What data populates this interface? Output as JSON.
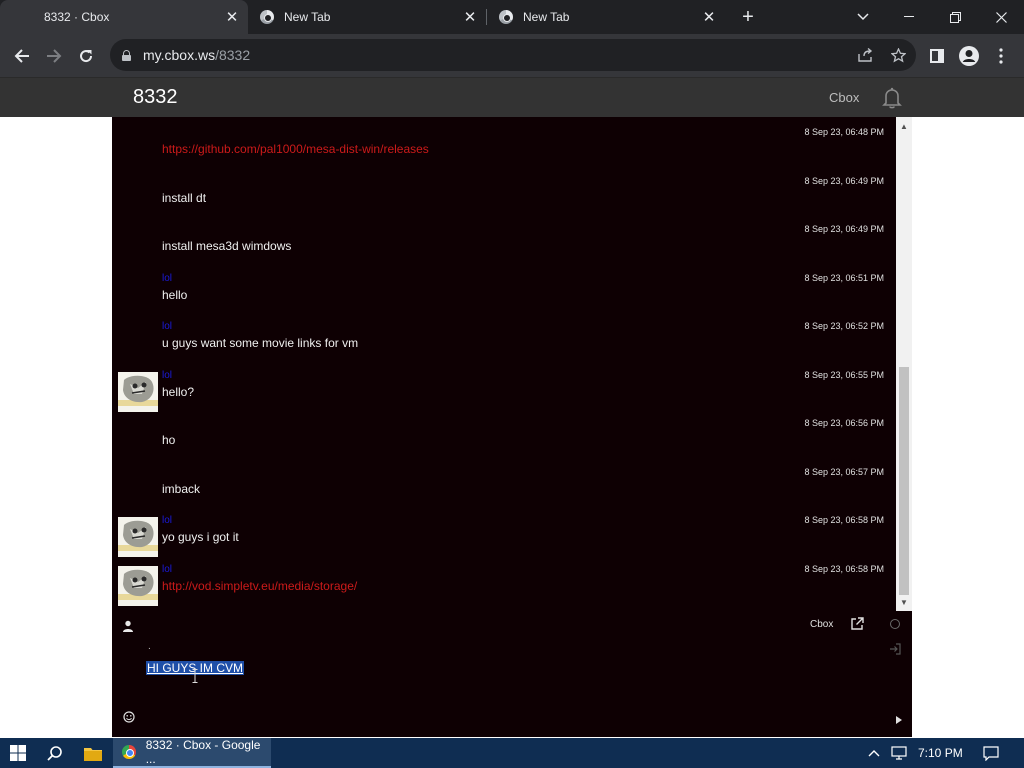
{
  "browser": {
    "tabs": [
      {
        "title": "8332 · Cbox",
        "active": true
      },
      {
        "title": "New Tab",
        "active": false
      },
      {
        "title": "New Tab",
        "active": false
      }
    ],
    "url_host": "my.cbox.ws",
    "url_path": "/8332"
  },
  "header": {
    "title": "8332",
    "brand": "Cbox"
  },
  "messages": [
    {
      "name": "",
      "text": "https://github.com/pal1000/mesa-dist-win/releases",
      "time": "8 Sep 23, 06:48 PM",
      "is_link": true,
      "has_avatar": false
    },
    {
      "name": "",
      "text": "install dt",
      "time": "8 Sep 23, 06:49 PM",
      "is_link": false,
      "has_avatar": false
    },
    {
      "name": "",
      "text": "install mesa3d wimdows",
      "time": "8 Sep 23, 06:49 PM",
      "is_link": false,
      "has_avatar": false
    },
    {
      "name": "lol",
      "text": "hello",
      "time": "8 Sep 23, 06:51 PM",
      "is_link": false,
      "has_avatar": false
    },
    {
      "name": "lol",
      "text": "u guys want some movie links for vm",
      "time": "8 Sep 23, 06:52 PM",
      "is_link": false,
      "has_avatar": false
    },
    {
      "name": "lol",
      "text": "hello?",
      "time": "8 Sep 23, 06:55 PM",
      "is_link": false,
      "has_avatar": true
    },
    {
      "name": "",
      "text": "ho",
      "time": "8 Sep 23, 06:56 PM",
      "is_link": false,
      "has_avatar": false
    },
    {
      "name": "",
      "text": "imback",
      "time": "8 Sep 23, 06:57 PM",
      "is_link": false,
      "has_avatar": false
    },
    {
      "name": "lol",
      "text": "yo guys i got it",
      "time": "8 Sep 23, 06:58 PM",
      "is_link": false,
      "has_avatar": true
    },
    {
      "name": "lol",
      "text": "http://vod.simpletv.eu/media/storage/",
      "time": "8 Sep 23, 06:58 PM",
      "is_link": true,
      "has_avatar": true
    }
  ],
  "composer": {
    "brand": "Cbox",
    "name_value": ".",
    "message_value": "HI GUYS IM CVM"
  },
  "taskbar": {
    "app_label": "8332 · Cbox - Google ...",
    "time": "7:10 PM"
  },
  "colors": {
    "chat_background": "#0e0003",
    "link": "#cc1a1a",
    "username": "#1a1adb",
    "selection": "#1f4fa8",
    "taskbar": "#0f2d52"
  }
}
